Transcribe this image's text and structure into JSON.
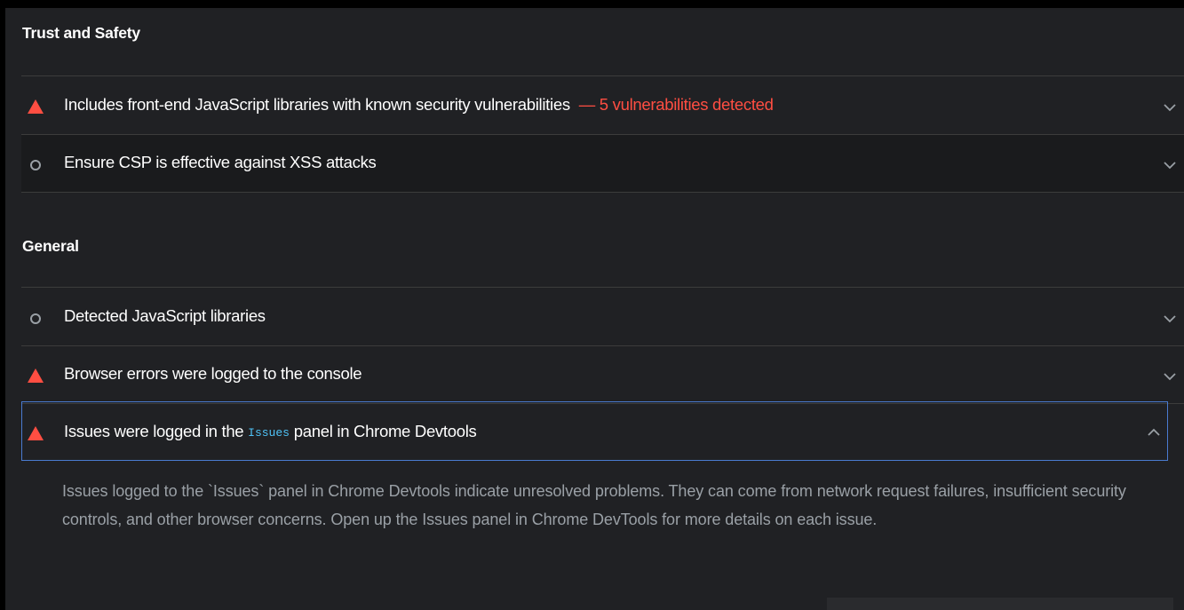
{
  "groups": {
    "trust_safety": {
      "title": "Trust and Safety"
    },
    "general": {
      "title": "General"
    }
  },
  "audits": [
    {
      "status": "fail",
      "title": "Includes front-end JavaScript libraries with known security vulnerabilities",
      "display_value": "— 5 vulnerabilities detected",
      "expanded": false
    },
    {
      "status": "informative",
      "title": "Ensure CSP is effective against XSS attacks",
      "expanded": false
    },
    {
      "status": "informative",
      "title": "Detected JavaScript libraries",
      "expanded": false
    },
    {
      "status": "fail",
      "title": "Browser errors were logged to the console",
      "expanded": false
    },
    {
      "status": "fail",
      "title_prefix": "Issues were logged in the",
      "title_code": "Issues",
      "title_suffix": "panel in Chrome Devtools",
      "expanded": true,
      "description": "Issues logged to the `Issues` panel in Chrome Devtools indicate unresolved problems. They can come from network request failures, insufficient security controls, and other browser concerns. Open up the Issues panel in Chrome DevTools for more details on each issue."
    }
  ],
  "colors": {
    "fail": "#ff4e42",
    "informative": "#9aa0a6",
    "focus_border": "#4a7bd0",
    "code": "#4fc3f7"
  },
  "icons": {
    "fail": "triangle-icon",
    "informative": "circle-icon",
    "collapsed": "chevron-down-icon",
    "expanded": "chevron-up-icon"
  }
}
